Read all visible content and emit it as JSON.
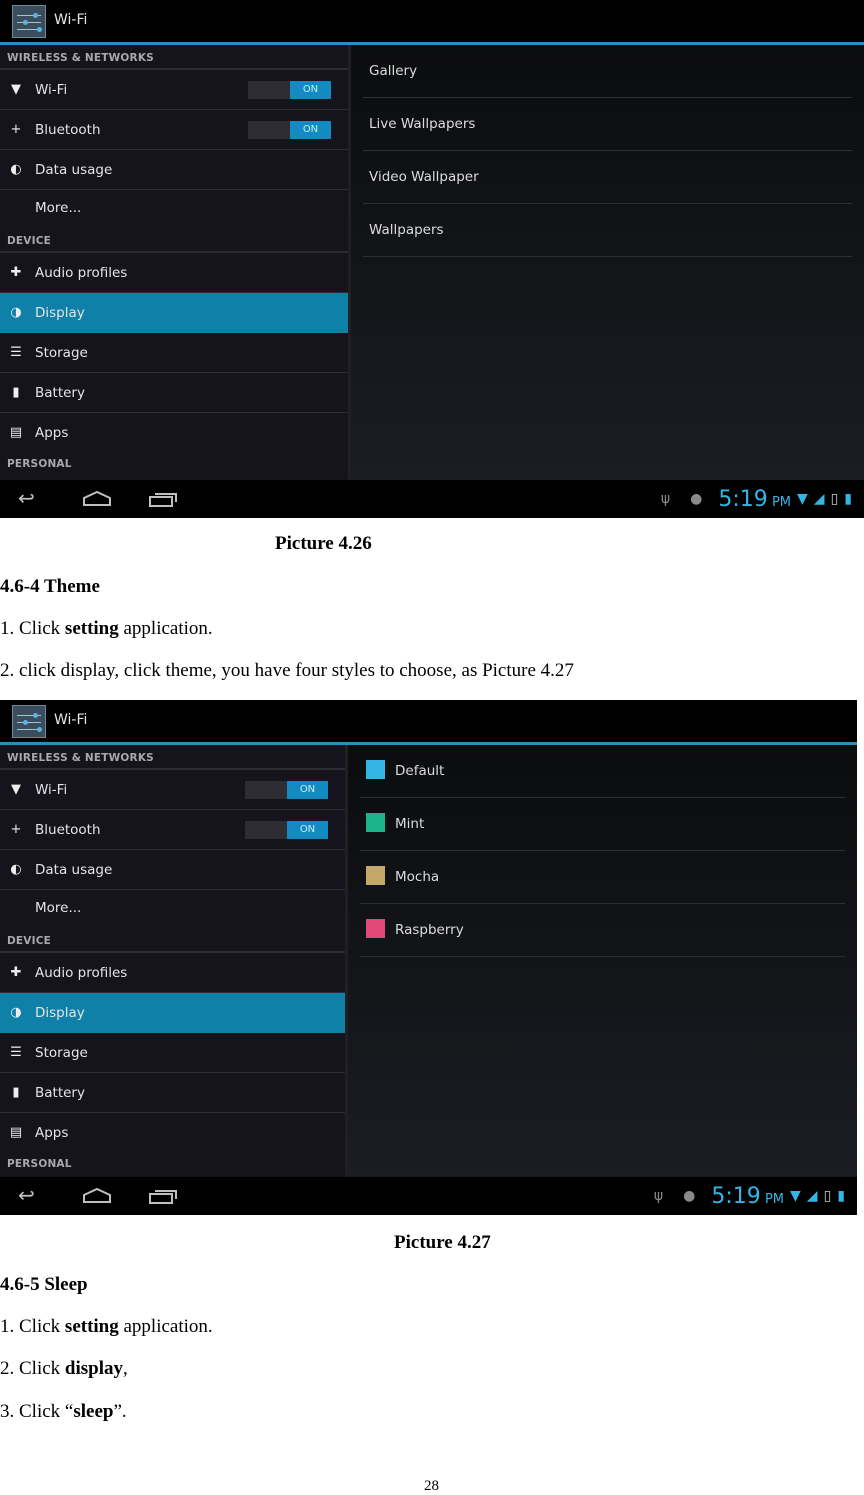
{
  "screenshots": [
    {
      "caption": "Picture 4.26",
      "action_bar_title": "Wi-Fi",
      "sidebar": {
        "sections": [
          {
            "header": "WIRELESS & NETWORKS",
            "items": [
              {
                "label": "Wi-Fi",
                "icon": "wifi-icon",
                "toggle": "ON"
              },
              {
                "label": "Bluetooth",
                "icon": "bluetooth-icon",
                "toggle": "ON"
              },
              {
                "label": "Data usage",
                "icon": "data-usage-icon"
              },
              {
                "label": "More...",
                "icon": ""
              }
            ]
          },
          {
            "header": "DEVICE",
            "items": [
              {
                "label": "Audio profiles",
                "icon": "audio-profiles-icon"
              },
              {
                "label": "Display",
                "icon": "display-icon",
                "selected": true
              },
              {
                "label": "Storage",
                "icon": "storage-icon"
              },
              {
                "label": "Battery",
                "icon": "battery-icon"
              },
              {
                "label": "Apps",
                "icon": "apps-icon"
              }
            ]
          },
          {
            "header": "PERSONAL",
            "items": []
          }
        ]
      },
      "right_list": [
        "Gallery",
        "Live Wallpapers",
        "Video Wallpaper",
        "Wallpapers"
      ],
      "status_bar": {
        "time": "5:19",
        "ampm": "PM"
      }
    },
    {
      "caption": "Picture 4.27",
      "action_bar_title": "Wi-Fi",
      "right_list": [
        {
          "label": "Default",
          "color": "#33b5e5"
        },
        {
          "label": "Mint",
          "color": "#1bb38a"
        },
        {
          "label": "Mocha",
          "color": "#c3a869"
        },
        {
          "label": "Raspberry",
          "color": "#e2497a"
        }
      ],
      "status_bar": {
        "time": "5:19",
        "ampm": "PM"
      }
    }
  ],
  "doc": {
    "theme_heading": "4.6-4 Theme",
    "theme_step1_pre": "1. Click ",
    "theme_step1_bold": "setting",
    "theme_step1_post": " application.",
    "theme_step2": "2. click display, click theme, you have four styles to choose, as Picture 4.27",
    "sleep_heading": "4.6-5 Sleep",
    "sleep_step1_pre": "1. Click ",
    "sleep_step1_bold": "setting",
    "sleep_step1_post": " application.",
    "sleep_step2_pre": "2. Click ",
    "sleep_step2_bold": "display",
    "sleep_step2_post": ",",
    "sleep_step3_pre": "3. Click “",
    "sleep_step3_bold": "sleep",
    "sleep_step3_post": "”.",
    "page_number": "28"
  }
}
